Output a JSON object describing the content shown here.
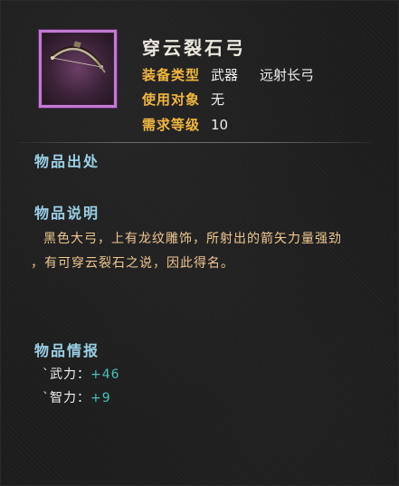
{
  "item": {
    "name": "穿云裂石弓",
    "icon": "bow-icon",
    "attributes": [
      {
        "label": "装备类型",
        "value": "武器",
        "extra": "远射长弓"
      },
      {
        "label": "使用对象",
        "value": "无"
      },
      {
        "label": "需求等级",
        "value": "10"
      }
    ]
  },
  "sections": {
    "source": {
      "title": "物品出处"
    },
    "description": {
      "title": "物品说明",
      "line1": "黑色大弓，上有龙纹雕饰，所射出的箭矢力量强劲",
      "line2": "，有可穿云裂石之说，因此得名。"
    },
    "info": {
      "title": "物品情报",
      "stats": [
        {
          "key": "`武力：",
          "value": "+46"
        },
        {
          "key": "`智力：",
          "value": "+9"
        }
      ]
    }
  },
  "colors": {
    "label": "#f1b63f",
    "section_title": "#9ad0e6",
    "description": "#f0c892",
    "stat_value": "#47c3ba",
    "icon_border": "#c27ad0"
  }
}
